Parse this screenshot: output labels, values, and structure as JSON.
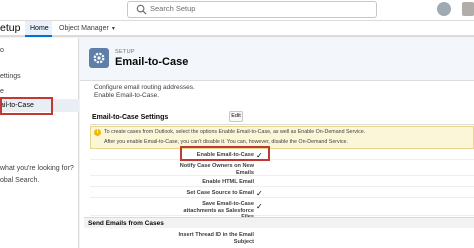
{
  "search": {
    "placeholder": "Search Setup"
  },
  "nav": {
    "app_name": "etup",
    "tabs": [
      {
        "label": "Home"
      },
      {
        "label": "Object Manager"
      }
    ]
  },
  "sidebar": {
    "items": [
      {
        "label": "o"
      },
      {
        "label": "ettings"
      },
      {
        "label": "e"
      },
      {
        "label": "ail-to-Case"
      },
      {
        "label": "what you're looking for?"
      },
      {
        "label": "obal Search."
      }
    ]
  },
  "header": {
    "eyebrow": "SETUP",
    "title": "Email-to-Case"
  },
  "description": {
    "line1": "Configure email routing addresses.",
    "line2": "Enable Email-to-Case."
  },
  "settings": {
    "title": "Email-to-Case Settings",
    "edit_label": "Edit",
    "info_line1": "To create cases from Outlook, select the options Enable Email-to-Case, as well as Enable On-Demand Service.",
    "info_line2": "After you enable Email-to-Case, you can't disable it. You can, however, disable the On-Demand Service.",
    "rows": [
      {
        "label": "Enable Email-to-Case",
        "checked": true,
        "check": "✓"
      },
      {
        "label": "Notify Case Owners on New Emails",
        "checked": false,
        "check": ""
      },
      {
        "label": "Enable HTML Email",
        "checked": false,
        "check": ""
      },
      {
        "label": "Set Case Source to Email",
        "checked": true,
        "check": "✓"
      },
      {
        "label": "Save Email-to-Case attachments as Salesforce Files",
        "checked": true,
        "check": "✓"
      }
    ]
  },
  "send_section": {
    "title": "Send Emails from Cases",
    "rows": [
      {
        "label": "Insert Thread ID in the Email Subject"
      }
    ]
  },
  "colors": {
    "highlight": "#c23934",
    "accent": "#0070d2"
  }
}
